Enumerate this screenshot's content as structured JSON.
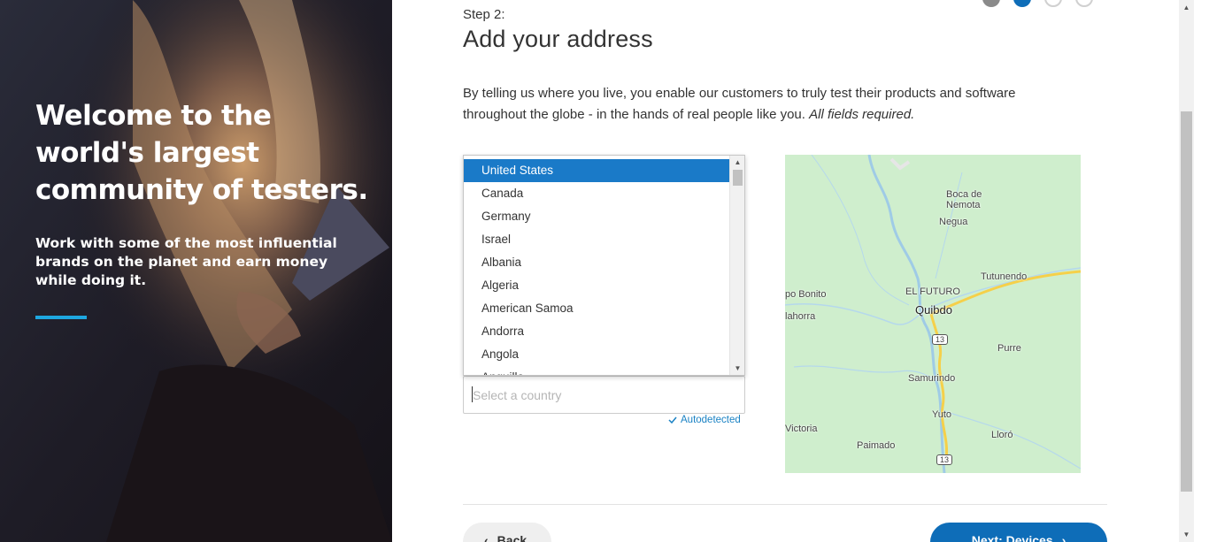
{
  "hero": {
    "headline": "Welcome to the world's largest community of testers.",
    "subtext": "Work with some of the most influential brands on the planet and earn money while doing it."
  },
  "header": {
    "step_label": "Step 2:",
    "title": "Add your address"
  },
  "intro": {
    "text": "By telling us where you live, you enable our customers to truly test their products and software throughout the globe - in the hands of real people like you. ",
    "emphasis": "All fields required."
  },
  "country": {
    "placeholder": "Select a country",
    "autodetected": "Autodetected",
    "options": [
      "United States",
      "Canada",
      "Germany",
      "Israel",
      "Albania",
      "Algeria",
      "American Samoa",
      "Andorra",
      "Angola",
      "Anguilla"
    ],
    "selected_index": 0
  },
  "map": {
    "labels": [
      "Boca de",
      "Nemota",
      "Negua",
      "Tutunendo",
      "EL FUTURO",
      "Quibdo",
      "po Bonito",
      "lahorra",
      "Purre",
      "Samurindo",
      "Yuto",
      "Lloró",
      "Victoria",
      "Paimado"
    ],
    "route_shields": [
      "13",
      "13"
    ]
  },
  "footer": {
    "back_label": "Back",
    "next_label": "Next: Devices"
  },
  "colors": {
    "accent_blue": "#0e6db8",
    "hero_rule": "#1ea7e0",
    "map_land": "#cfeecd",
    "map_river": "#9fcbe6",
    "map_road": "#f5d04a"
  }
}
